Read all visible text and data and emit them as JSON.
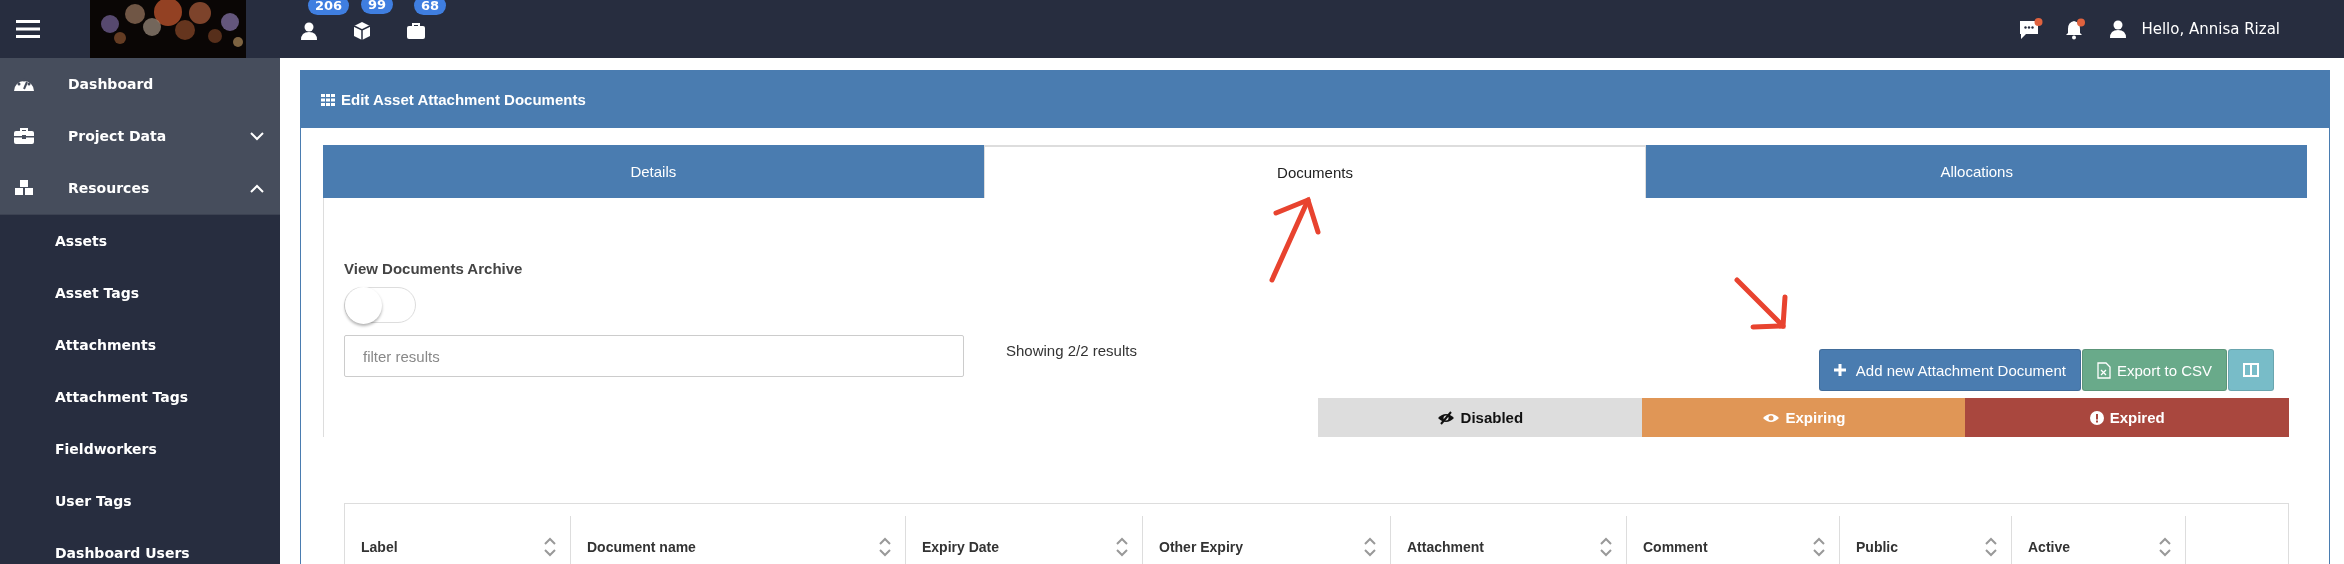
{
  "topbar": {
    "badges": [
      {
        "count": "206"
      },
      {
        "count": "99"
      },
      {
        "count": "68"
      }
    ],
    "greeting": "Hello, Annisa Rizal"
  },
  "sidebar": {
    "items": [
      {
        "kind": "link",
        "label": "Dashboard"
      },
      {
        "kind": "group",
        "label": "Project Data",
        "expanded": false
      },
      {
        "kind": "group",
        "label": "Resources",
        "expanded": true,
        "children": [
          {
            "label": "Assets"
          },
          {
            "label": "Asset Tags"
          },
          {
            "label": "Attachments"
          },
          {
            "label": "Attachment Tags"
          },
          {
            "label": "Fieldworkers"
          },
          {
            "label": "User Tags"
          },
          {
            "label": "Dashboard Users"
          }
        ]
      }
    ]
  },
  "panel": {
    "title": "Edit Asset Attachment Documents"
  },
  "tabs": [
    {
      "label": "Details",
      "selected": false
    },
    {
      "label": "Documents",
      "selected": true
    },
    {
      "label": "Allocations",
      "selected": false
    }
  ],
  "archive_toggle": {
    "label": "View Documents Archive",
    "on": false
  },
  "filter": {
    "placeholder": "filter results"
  },
  "results": "Showing 2/2 results",
  "buttons": [
    {
      "kind": "add",
      "label": "Add new Attachment Document"
    },
    {
      "kind": "export",
      "label": "Export to CSV"
    },
    {
      "kind": "columns"
    }
  ],
  "legend": [
    {
      "kind": "disabled",
      "label": "Disabled",
      "color": "#dddddd"
    },
    {
      "kind": "expiring",
      "label": "Expiring",
      "color": "#e09656"
    },
    {
      "kind": "expired",
      "label": "Expired",
      "color": "#a9473e"
    }
  ],
  "table": {
    "columns": [
      "Label",
      "Document name",
      "Expiry Date",
      "Other Expiry",
      "Attachment",
      "Comment",
      "Public",
      "Active"
    ]
  }
}
